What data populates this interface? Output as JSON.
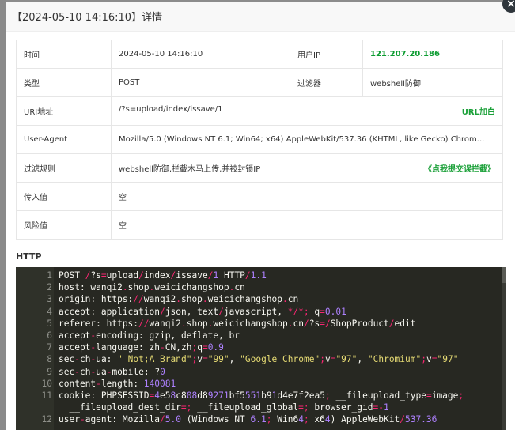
{
  "modal": {
    "title": "【2024-05-10 14:16:10】详情",
    "close_label": "×"
  },
  "details": {
    "time_label": "时间",
    "time_value": "2024-05-10 14:16:10",
    "ip_label": "用户IP",
    "ip_value": "121.207.20.186",
    "type_label": "类型",
    "type_value": "POST",
    "filter_label": "过滤器",
    "filter_value": "webshell防御",
    "uri_label": "URI地址",
    "uri_value": "/?s=upload/index/issave/1",
    "uri_action": "URL加白",
    "ua_label": "User-Agent",
    "ua_value": "Mozilla/5.0 (Windows NT 6.1; Win64; x64) AppleWebKit/537.36 (KHTML, like Gecko) Chrom...",
    "rule_label": "过滤规则",
    "rule_value": "webshell防御,拦截木马上传,并被封锁IP",
    "rule_action": "《点我提交误拦截》",
    "input_label": "传入值",
    "input_value": "空",
    "risk_label": "风险值",
    "risk_value": "空"
  },
  "http": {
    "section_title": "HTTP",
    "lines": [
      {
        "n": "1",
        "text": "POST /?s=upload/index/issave/1 HTTP/1.1"
      },
      {
        "n": "2",
        "text": "host: wanqi2.shop.weicichangshop.cn"
      },
      {
        "n": "3",
        "text": "origin: https://wanqi2.shop.weicichangshop.cn"
      },
      {
        "n": "4",
        "text": "accept: application/json, text/javascript, */*; q=0.01"
      },
      {
        "n": "5",
        "text": "referer: https://wanqi2.shop.weicichangshop.cn/?s=/ShopProduct/edit"
      },
      {
        "n": "6",
        "text": "accept-encoding: gzip, deflate, br"
      },
      {
        "n": "7",
        "text": "accept-language: zh-CN,zh;q=0.9"
      },
      {
        "n": "8",
        "text": "sec-ch-ua: \" Not;A Brand\";v=\"99\", \"Google Chrome\";v=\"97\", \"Chromium\";v=\"97\""
      },
      {
        "n": "9",
        "text": "sec-ch-ua-mobile: ?0"
      },
      {
        "n": "10",
        "text": "content-length: 140081"
      },
      {
        "n": "11",
        "text": "cookie: PHPSESSID=4e58c808d89271bf5551b91d4e7f2ea5; __fileupload_type=image;"
      },
      {
        "n": "",
        "text": "  __fileupload_dest_dir=; __fileupload_global=; browser_gid=-1"
      },
      {
        "n": "12",
        "text": "user-agent: Mozilla/5.0 (Windows NT 6.1; Win64; x64) AppleWebKit/537.36"
      }
    ]
  }
}
